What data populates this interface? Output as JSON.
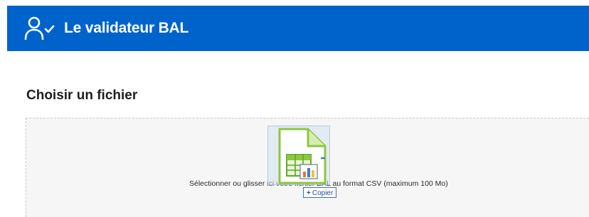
{
  "header": {
    "title": "Le validateur BAL",
    "background_color": "#0063cb",
    "icon": "user-check-icon"
  },
  "main": {
    "section_title": "Choisir un fichier",
    "dropzone": {
      "hint": "Sélectionner ou glisser ici votre fichier BAL au format CSV (maximum 100 Mo)"
    },
    "drag": {
      "file_icon": "spreadsheet-file-icon",
      "action_plus": "+",
      "action_label": "Copier"
    }
  }
}
